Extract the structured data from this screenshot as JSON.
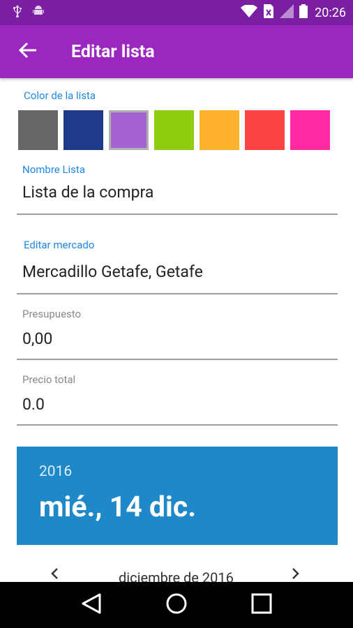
{
  "status_bar": {
    "time": "20:26",
    "icons": [
      "usb-icon",
      "android-debug-icon",
      "wifi-icon",
      "no-sim-icon",
      "signal-icon",
      "battery-icon"
    ]
  },
  "app_bar": {
    "back_icon": "arrow-left-icon",
    "title": "Editar lista"
  },
  "form": {
    "color_label": "Color de la lista",
    "colors": [
      "#666666",
      "#1f3a8a",
      "#a463d1",
      "#8fcc0e",
      "#ffb22e",
      "#fc4344",
      "#ff2aa1"
    ],
    "selected_color_index": 2,
    "name_label": "Nombre Lista",
    "name_value": "Lista de la compra",
    "market_label": "Editar mercado",
    "market_value": "Mercadillo Getafe, Getafe",
    "budget_label": "Presupuesto",
    "budget_value": "0,00",
    "total_label": "Precio total",
    "total_value": "0.0"
  },
  "date_picker": {
    "year": "2016",
    "date": "mié., 14 dic.",
    "month_label": "diciembre de 2016",
    "prev_icon": "chevron-left-icon",
    "next_icon": "chevron-right-icon",
    "accent": "#1e88c8"
  },
  "nav_bar": {
    "back_icon": "triangle-back-icon",
    "home_icon": "circle-home-icon",
    "recents_icon": "square-recents-icon"
  },
  "theme": {
    "status_bar": "#7b1fa2",
    "app_bar": "#9c27c0"
  }
}
